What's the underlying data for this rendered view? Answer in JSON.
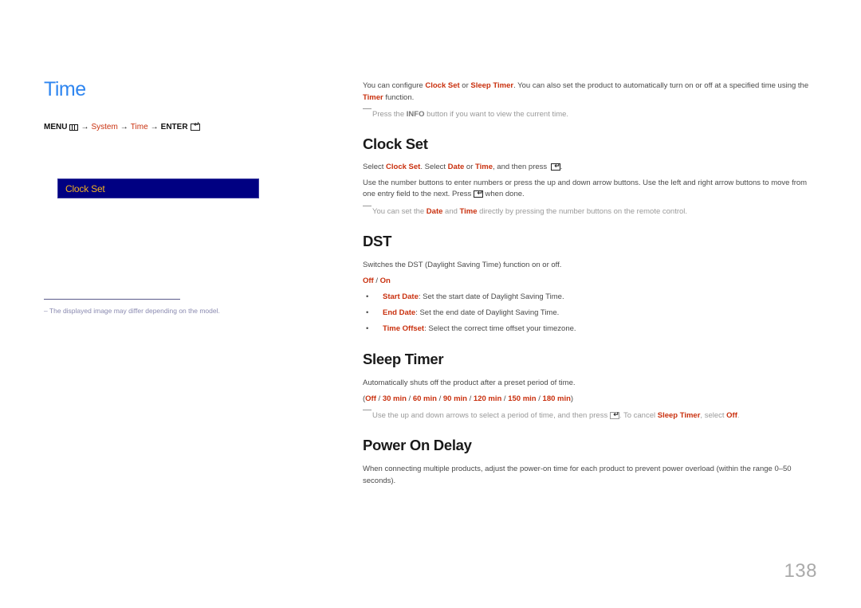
{
  "left": {
    "title": "Time",
    "menu_path": {
      "menu": "MENU",
      "arrow": "→",
      "system": "System",
      "time": "Time",
      "enter": "ENTER"
    },
    "osd_item": "Clock Set",
    "footnote": "–  The displayed image may differ depending on the model."
  },
  "intro": {
    "p1_a": "You can configure ",
    "p1_hl1": "Clock Set",
    "p1_b": " or ",
    "p1_hl2": "Sleep Timer",
    "p1_c": ". You can also set the product to automatically turn on or off at a specified time using the ",
    "p1_hl3": "Timer",
    "p1_d": " function.",
    "note_a": "Press the ",
    "note_b": "INFO",
    "note_c": " button if you want to view the current time."
  },
  "clock_set": {
    "heading": "Clock Set",
    "p1_a": "Select ",
    "p1_hl1": "Clock Set",
    "p1_b": ". Select ",
    "p1_hl2": "Date",
    "p1_c": " or ",
    "p1_hl3": "Time",
    "p1_d": ", and then press ",
    "p1_e": ".",
    "p2_a": "Use the number buttons to enter numbers or press the up and down arrow buttons. Use the left and right arrow buttons to move from one entry field to the next. Press ",
    "p2_b": " when done.",
    "note_a": "You can set the ",
    "note_hl1": "Date",
    "note_b": " and ",
    "note_hl2": "Time",
    "note_c": " directly by pressing the number buttons on the remote control."
  },
  "dst": {
    "heading": "DST",
    "desc": "Switches the DST (Daylight Saving Time) function on or off.",
    "opt_off": "Off",
    "sep": " / ",
    "opt_on": "On",
    "bullets": [
      {
        "label": "Start Date",
        "text": ": Set the start date of Daylight Saving Time."
      },
      {
        "label": "End Date",
        "text": ": Set the end date of Daylight Saving Time."
      },
      {
        "label": "Time Offset",
        "text": ": Select the correct time offset your timezone."
      }
    ]
  },
  "sleep_timer": {
    "heading": "Sleep Timer",
    "desc": "Automatically shuts off the product after a preset period of time.",
    "options": [
      "Off",
      "30 min",
      "60 min",
      "90 min",
      "120 min",
      "150 min",
      "180 min"
    ],
    "open_paren": "(",
    "close_paren": ")",
    "sep": " / ",
    "note_a": "Use the up and down arrows to select a period of time, and then press ",
    "note_b": ". To cancel ",
    "note_hl1": "Sleep Timer",
    "note_c": ", select ",
    "note_hl2": "Off",
    "note_d": "."
  },
  "power_on_delay": {
    "heading": "Power On Delay",
    "desc": "When connecting multiple products, adjust the power-on time for each product to prevent power overload (within the range 0–50 seconds)."
  },
  "page_number": "138"
}
